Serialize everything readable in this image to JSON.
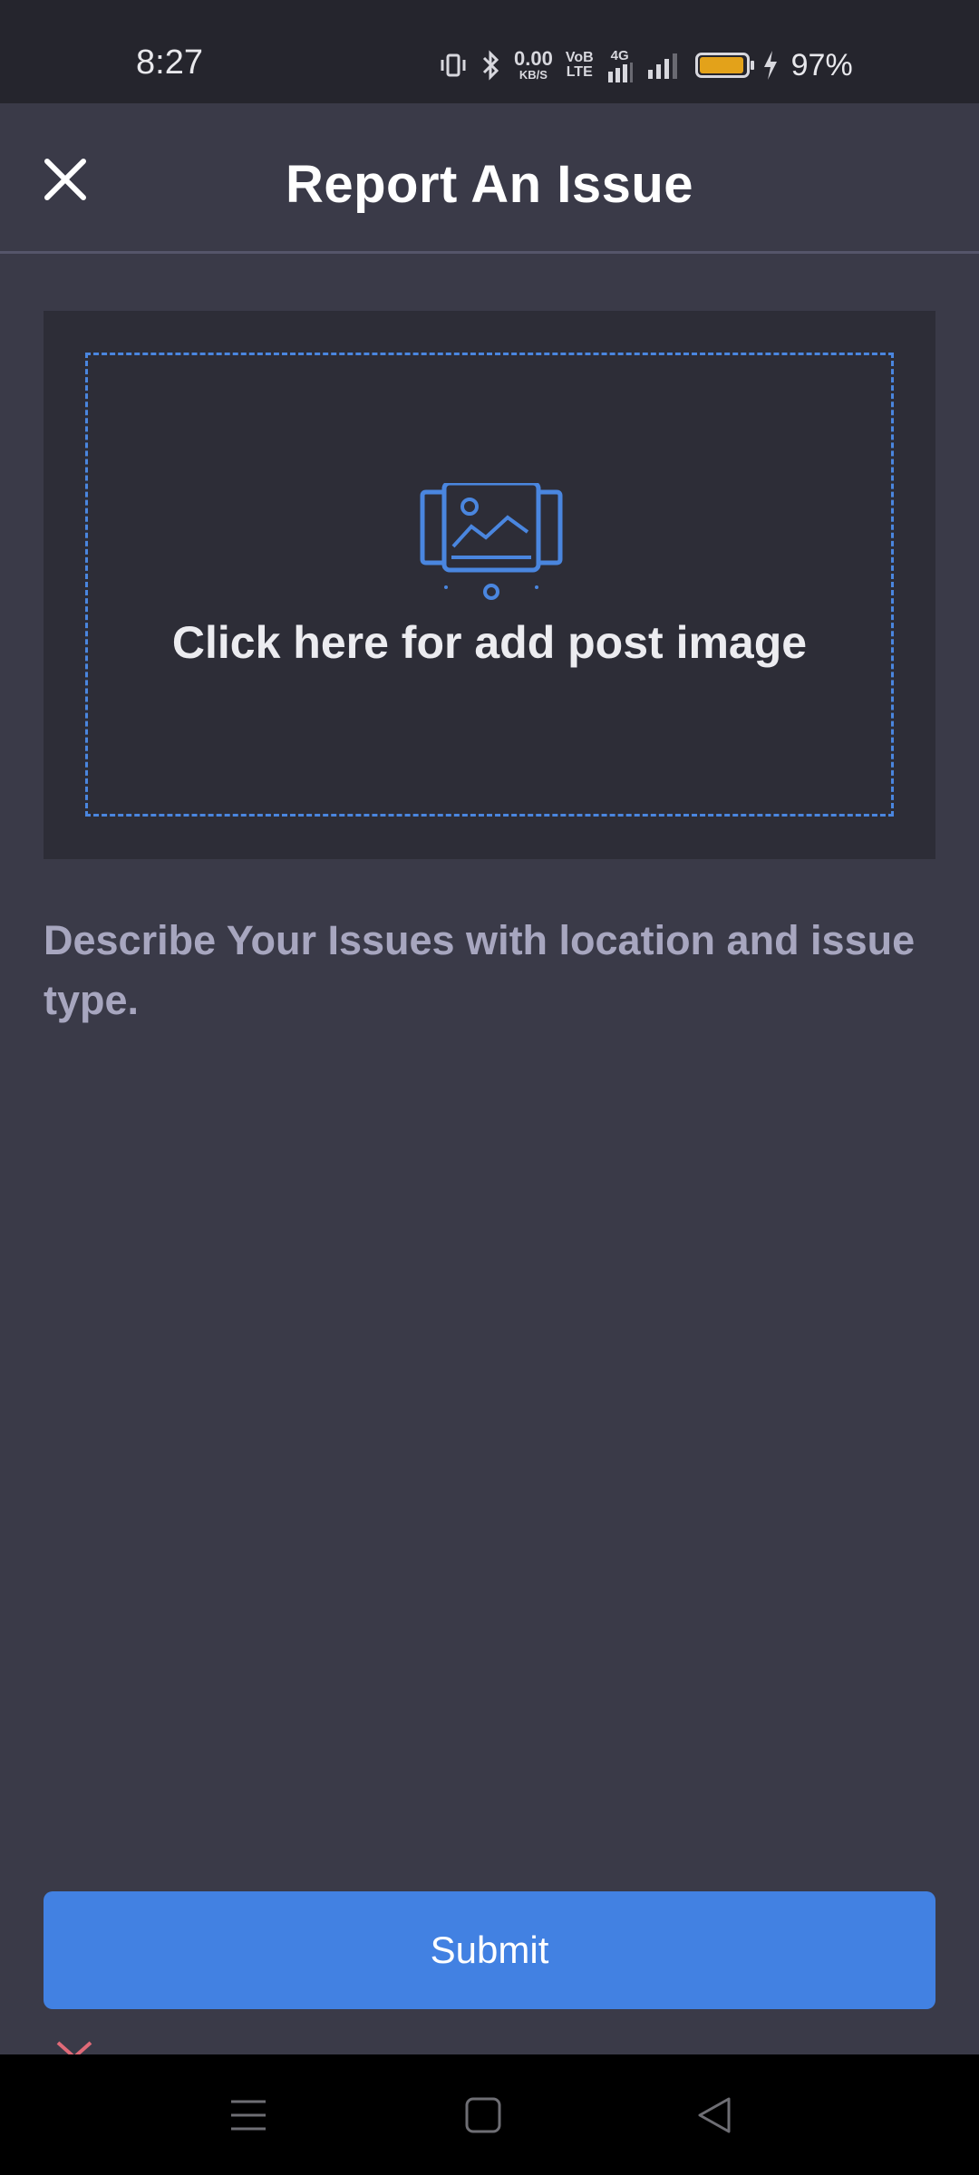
{
  "status_bar": {
    "time": "8:27",
    "speed_value": "0.00",
    "speed_unit": "KB/S",
    "volte_top": "VoB",
    "volte_bottom": "LTE",
    "network": "4G",
    "battery_percent": "97%",
    "battery_color": "#e3a21a"
  },
  "header": {
    "title": "Report An Issue",
    "close_icon": "close-icon"
  },
  "upload": {
    "label": "Click here for add post image",
    "icon": "image-upload-icon",
    "accent_color": "#4a86df"
  },
  "description": {
    "placeholder": "Describe Your Issues with location and issue type."
  },
  "submit": {
    "label": "Submit",
    "color": "#4281e2"
  },
  "nav": {
    "items": [
      "menu-icon",
      "home-icon",
      "back-icon"
    ]
  }
}
